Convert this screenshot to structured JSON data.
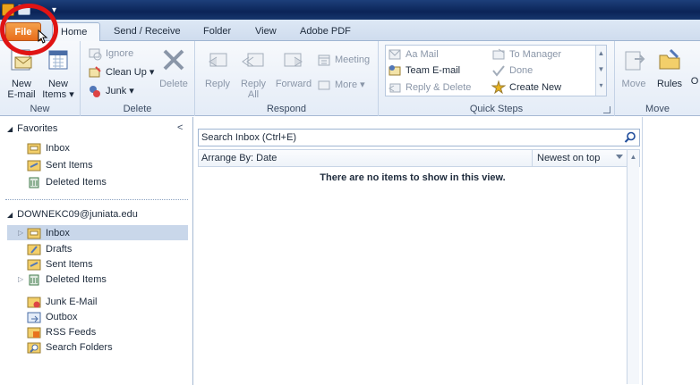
{
  "tabs": {
    "file": "File",
    "home": "Home",
    "send_receive": "Send / Receive",
    "folder": "Folder",
    "view": "View",
    "adobe_pdf": "Adobe PDF"
  },
  "ribbon": {
    "new_group": {
      "label": "New",
      "new_email_line1": "New",
      "new_email_line2": "E-mail",
      "new_items_line1": "New",
      "new_items_line2": "Items ▾"
    },
    "delete_group": {
      "label": "Delete",
      "ignore": "Ignore",
      "clean_up": "Clean Up ▾",
      "junk": "Junk ▾",
      "delete": "Delete"
    },
    "respond_group": {
      "label": "Respond",
      "reply": "Reply",
      "reply_all_line1": "Reply",
      "reply_all_line2": "All",
      "forward": "Forward",
      "meeting": "Meeting",
      "more": "More ▾"
    },
    "quick_steps_group": {
      "label": "Quick Steps",
      "aa_mail": "Aa Mail",
      "team_email": "Team E-mail",
      "reply_delete": "Reply & Delete",
      "to_manager": "To Manager",
      "done": "Done",
      "create_new": "Create New"
    },
    "move_group": {
      "label": "Move",
      "move": "Move",
      "rules": "Rules",
      "onenote_partial": "O"
    }
  },
  "nav": {
    "favorites_header": "Favorites",
    "favorites": [
      {
        "label": "Inbox"
      },
      {
        "label": "Sent Items"
      },
      {
        "label": "Deleted Items"
      }
    ],
    "account_header": "DOWNEKC09@juniata.edu",
    "account_folders": [
      {
        "label": "Inbox"
      },
      {
        "label": "Drafts"
      },
      {
        "label": "Sent Items"
      },
      {
        "label": "Deleted Items"
      },
      {
        "label": "Junk E-Mail"
      },
      {
        "label": "Outbox"
      },
      {
        "label": "RSS Feeds"
      },
      {
        "label": "Search Folders"
      }
    ]
  },
  "content": {
    "search_placeholder": "Search Inbox (Ctrl+E)",
    "arrange_by": "Arrange By: Date",
    "sort_order": "Newest on top",
    "empty_message": "There are no items to show in this view."
  },
  "colors": {
    "file_tab": "#e86d1b",
    "highlight_circle": "#e01414",
    "selected_folder": "#c9d7ea"
  }
}
